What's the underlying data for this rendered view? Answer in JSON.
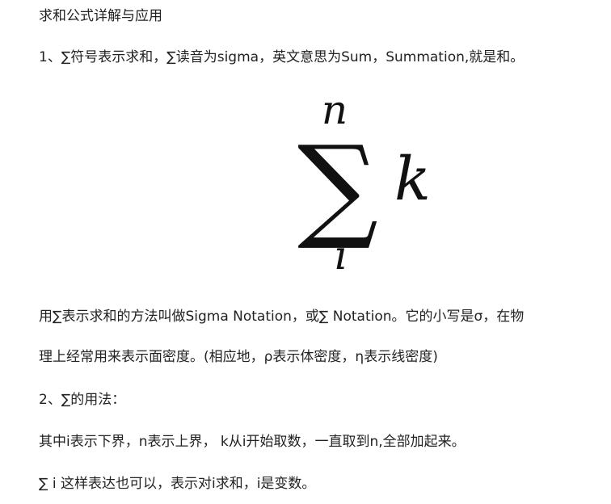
{
  "article": {
    "title": "求和公式详解与应用",
    "para1": "1、∑符号表示求和，∑读音为sigma，英文意思为Sum，Summation,就是和。",
    "formula": {
      "operator": "∑",
      "upper": "n",
      "lower": "i",
      "term": "k"
    },
    "para2_line1": "用∑表示求和的方法叫做Sigma Notation，或∑ Notation。它的小写是σ，在物",
    "para2_line2": "理上经常用来表示面密度。(相应地，ρ表示体密度，η表示线密度)",
    "para3": "2、∑的用法：",
    "para4": "其中i表示下界，n表示上界， k从i开始取数，一直取到n,全部加起来。",
    "para5": "∑ i 这样表达也可以，表示对i求和，i是变数。"
  }
}
